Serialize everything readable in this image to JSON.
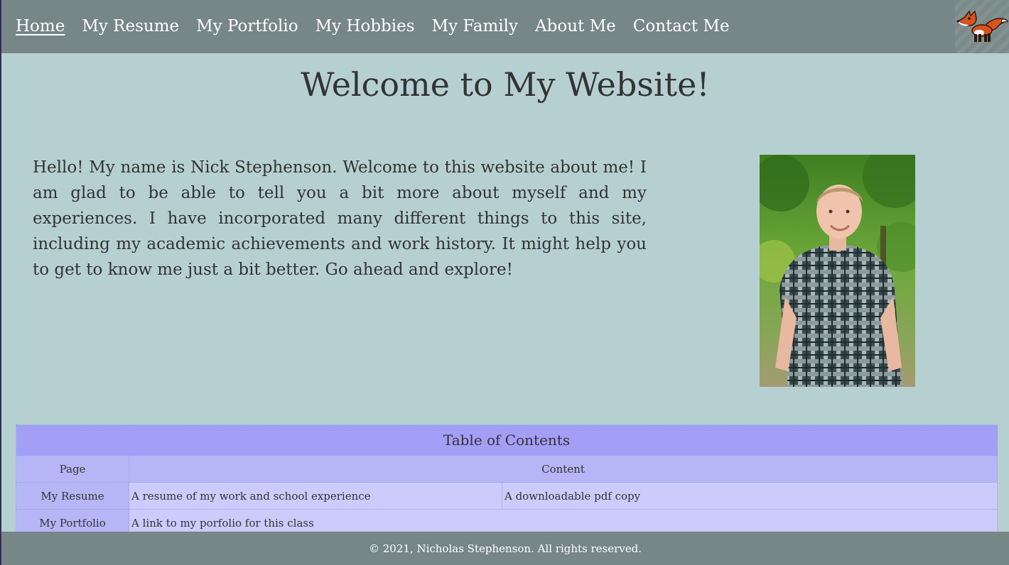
{
  "nav": {
    "items": [
      {
        "label": "Home",
        "active": true
      },
      {
        "label": "My Resume",
        "active": false
      },
      {
        "label": "My Portfolio",
        "active": false
      },
      {
        "label": "My Hobbies",
        "active": false
      },
      {
        "label": "My Family",
        "active": false
      },
      {
        "label": "About Me",
        "active": false
      },
      {
        "label": "Contact Me",
        "active": false
      }
    ],
    "logo_icon": "fox-icon"
  },
  "main": {
    "title": "Welcome to My Website!",
    "intro": "Hello! My name is Nick Stephenson. Welcome to this website about me! I am glad to be able to tell you a bit more about myself and my experiences. I have incorporated many different things to this site, including my academic achievements and work history. It might help you to get to know me just a bit better. Go ahead and explore!",
    "portrait_icon": "portrait-photo"
  },
  "toc": {
    "caption": "Table of Contents",
    "headers": {
      "page": "Page",
      "content": "Content"
    },
    "rows": [
      {
        "page": "My Resume",
        "content_a": "A resume of my work and school experience",
        "content_b": "A downloadable pdf copy"
      },
      {
        "page": "My Portfolio",
        "content_a": "A link to my porfolio for this class",
        "content_b": ""
      }
    ]
  },
  "footer": {
    "text": "© 2021, Nicholas Stephenson. All rights reserved."
  },
  "colors": {
    "background": "#b6d0d2",
    "nav_bar": "#778687",
    "table_caption": "#a39ff7",
    "table_header": "#b6b5f6",
    "table_row": "#cdcbfb",
    "text": "#333333"
  }
}
